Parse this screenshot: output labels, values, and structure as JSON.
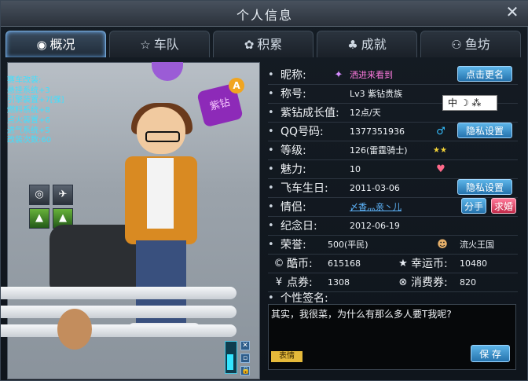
{
  "title": "个人信息",
  "close_icon": "✕",
  "tabs": [
    {
      "label": "概况",
      "icon": "◉"
    },
    {
      "label": "车队",
      "icon": "☆"
    },
    {
      "label": "积累",
      "icon": "✿"
    },
    {
      "label": "成就",
      "icon": "♣"
    },
    {
      "label": "鱼坊",
      "icon": "⚇"
    }
  ],
  "stats": [
    "赛车改装:",
    "悬挂系统+3",
    "引擎装置+7[强]",
    "燃料系统+8",
    "点火装置+6",
    "进气系统+5",
    "改装次数:60"
  ],
  "badge": {
    "text": "紫钻",
    "corner": "A"
  },
  "ime": "中 ☽ ⁂",
  "fields": {
    "nickname": {
      "label": "昵称:",
      "value": "洒进来看到"
    },
    "title": {
      "label": "称号:",
      "value": "Lv3 紫钻贵族"
    },
    "growth": {
      "label": "紫钻成长值:",
      "value": "12点/天"
    },
    "qq": {
      "label": "QQ号码:",
      "value": "1377351936"
    },
    "level": {
      "label": "等级:",
      "value": "126(雷霆骑士)"
    },
    "charm": {
      "label": "魅力:",
      "value": "10"
    },
    "birthday": {
      "label": "飞车生日:",
      "value": "2011-03-06"
    },
    "partner": {
      "label": "情侣:",
      "value": "〆香灬亲丶儿"
    },
    "anniversary": {
      "label": "纪念日:",
      "value": "2012-06-19"
    },
    "honor": {
      "label": "荣誉:",
      "value": "500(平民)",
      "extra": "流火王国"
    }
  },
  "currency": {
    "coolcoin": {
      "label": "酷币:",
      "value": "615168"
    },
    "luckycoin": {
      "label": "幸运币:",
      "value": "10480"
    },
    "voucher": {
      "label": "点券:",
      "value": "1308"
    },
    "consumption": {
      "label": "消费券:",
      "value": "820"
    }
  },
  "signature": {
    "label": "个性签名:",
    "text": "其实，我很菜，为什么有那么多人要T我呢?"
  },
  "buttons": {
    "rename": "点击更名",
    "privacy1": "隐私设置",
    "privacy2": "隐私设置",
    "breakup": "分手",
    "propose": "求婚",
    "save": "保 存",
    "emoji": "表情"
  },
  "colors": {
    "accent": "#35c0ff",
    "stats": "#3fe0ff"
  }
}
